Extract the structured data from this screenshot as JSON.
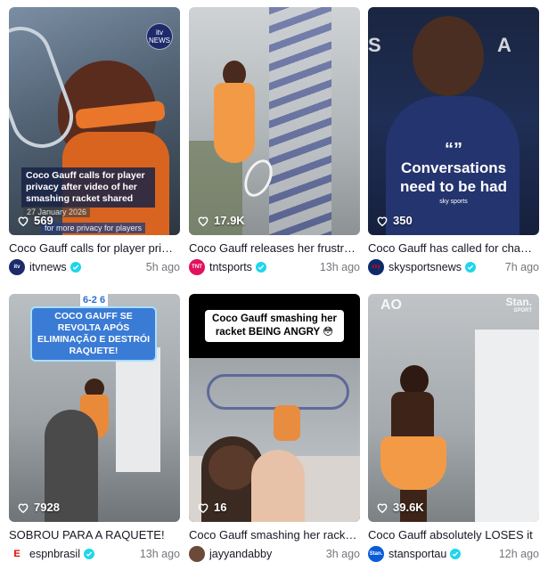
{
  "videos": [
    {
      "likes": "569",
      "title": "Coco Gauff calls for player privacy after video of her smashing racket shared",
      "username": "itvnews",
      "time": "5h ago",
      "overlay": {
        "headline": "Coco Gauff calls for player privacy after video of her smashing racket shared",
        "date": "27 January 2026",
        "footer": "for more privacy for players",
        "badge_line1": "itv",
        "badge_line2": "NEWS"
      }
    },
    {
      "likes": "17.9K",
      "title": "Coco Gauff releases her frustrations after losing",
      "username": "tntsports",
      "time": "13h ago",
      "avatar_text": "TNT"
    },
    {
      "likes": "350",
      "title": "Coco Gauff has called for changes",
      "username": "skysportsnews",
      "time": "7h ago",
      "overlay": {
        "quote": "“”",
        "headline": "Conversations need to be had",
        "brand": "sky sports"
      }
    },
    {
      "likes": "7928",
      "title": "SOBROU PARA A RAQUETE!",
      "username": "espnbrasil",
      "time": "13h ago",
      "overlay": {
        "score": "6-2 6",
        "headline": "COCO GAUFF SE REVOLTA APÓS ELIMINAÇÃO E DESTRÓI RAQUETE!"
      }
    },
    {
      "likes": "16",
      "title": "Coco Gauff smashing her racket BEING ANGRY",
      "username": "jayyandabby",
      "time": "3h ago",
      "overlay": {
        "headline": "Coco Gauff smashing her racket BEING ANGRY 😳"
      }
    },
    {
      "likes": "39.6K",
      "title": "Coco Gauff absolutely LOSES it",
      "username": "stansportau",
      "time": "12h ago",
      "overlay": {
        "left_logo": "AO",
        "right_logo": "Stan.",
        "right_sub": "SPORT"
      }
    }
  ],
  "colors": {
    "verified": "#20d5ec",
    "muted_text": "#8a8b91"
  }
}
